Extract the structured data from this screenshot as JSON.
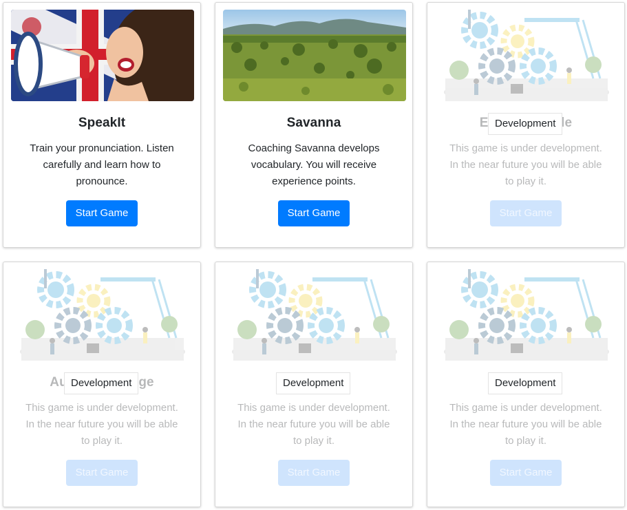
{
  "cards": [
    {
      "title": "SpeakIt",
      "description": "Train your pronunciation. Listen carefully and learn how to pronounce.",
      "button": "Start Game",
      "status": "active"
    },
    {
      "title": "Savanna",
      "description": "Coaching Savanna develops vocabulary. You will receive experience points.",
      "button": "Start Game",
      "status": "active"
    },
    {
      "title": "English Puzzle",
      "description": "This game is under development. In the near future you will be able to play it.",
      "button": "Start Game",
      "badge": "Development",
      "status": "development"
    },
    {
      "title": "Audio Challenge",
      "description": "This game is under development. In the near future you will be able to play it.",
      "button": "Start Game",
      "badge": "Development",
      "status": "development"
    },
    {
      "title": "",
      "description": "This game is under development. In the near future you will be able to play it.",
      "button": "Start Game",
      "badge": "Development",
      "status": "development"
    },
    {
      "title": "",
      "description": "This game is under development. In the near future you will be able to play it.",
      "button": "Start Game",
      "badge": "Development",
      "status": "development"
    }
  ],
  "colors": {
    "primary": "#007bff",
    "disabled_button": "#cfe4fd"
  }
}
